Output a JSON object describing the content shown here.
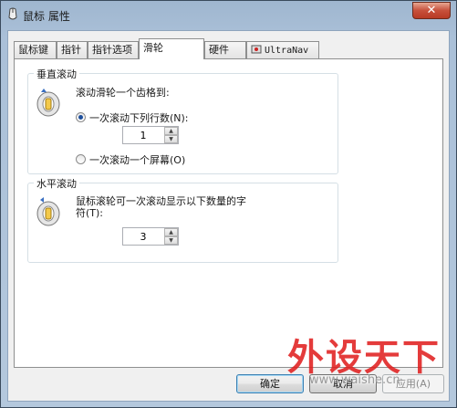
{
  "window": {
    "title": "鼠标 属性",
    "close_glyph": "✕"
  },
  "tabs": [
    {
      "label": "鼠标键",
      "active": false
    },
    {
      "label": "指针",
      "active": false
    },
    {
      "label": "指针选项",
      "active": false
    },
    {
      "label": "滑轮",
      "active": true
    },
    {
      "label": "硬件",
      "active": false
    },
    {
      "label": "UltraNav",
      "active": false
    }
  ],
  "vertical": {
    "title": "垂直滚动",
    "prompt": "滚动滑轮一个齿格到:",
    "option_lines": {
      "label": "一次滚动下列行数(N):",
      "selected": true
    },
    "lines_value": "1",
    "option_screen": {
      "label": "一次滚动一个屏幕(O)",
      "selected": false
    }
  },
  "horizontal": {
    "title": "水平滚动",
    "prompt_line1": "鼠标滚轮可一次滚动显示以下数量的字",
    "prompt_line2": "符(T):",
    "chars_value": "3"
  },
  "buttons": {
    "ok": "确定",
    "cancel": "取消",
    "apply": "应用(A)"
  },
  "watermark": {
    "big": "外设天下",
    "small": "www.waishe.cn"
  }
}
